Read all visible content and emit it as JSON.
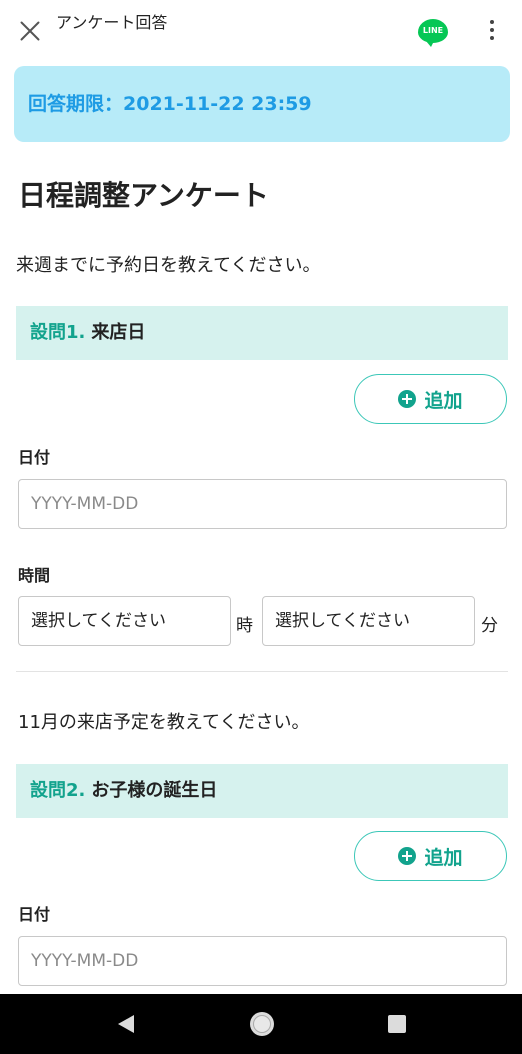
{
  "header": {
    "title": "アンケート回答",
    "line_icon_text": "LINE"
  },
  "deadline": {
    "text": "回答期限：2021-11-22 23:59"
  },
  "survey": {
    "title": "日程調整アンケート",
    "description": "来週までに予約日を教えてください。"
  },
  "questions": [
    {
      "number": "設問1.",
      "label": "来店日",
      "add_label": "追加",
      "date_label": "日付",
      "date_placeholder": "YYYY-MM-DD",
      "time_label": "時間",
      "hour_select": "選択してください",
      "hour_unit": "時",
      "minute_select": "選択してください",
      "minute_unit": "分"
    },
    {
      "intro": "11月の来店予定を教えてください。",
      "number": "設問2.",
      "label": "お子様の誕生日",
      "add_label": "追加",
      "date_label": "日付",
      "date_placeholder": "YYYY-MM-DD"
    }
  ],
  "colors": {
    "deadline_bg": "#b7ebf8",
    "deadline_text": "#1e9be4",
    "accent": "#12a38d",
    "question_bg": "#d6f2ee",
    "line_green": "#06c755"
  },
  "icons": [
    "close-icon",
    "line-icon",
    "more-vertical-icon",
    "plus-circle-icon",
    "nav-back-icon",
    "nav-home-icon",
    "nav-recent-icon"
  ]
}
